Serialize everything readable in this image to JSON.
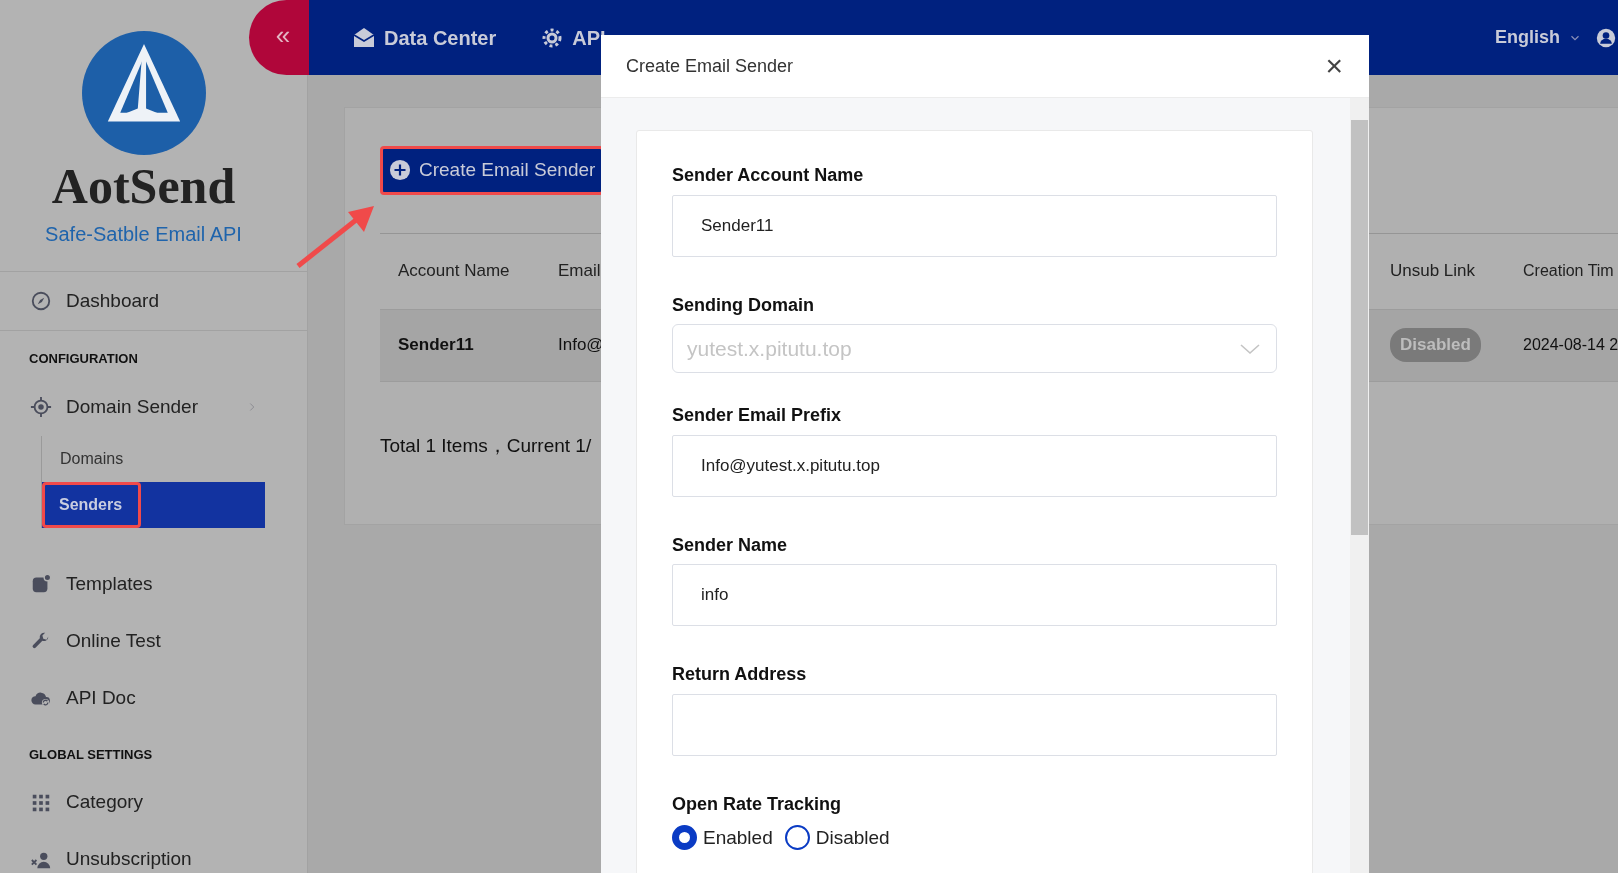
{
  "sidebar": {
    "collapse_button": "«",
    "logo": {
      "name": "AotSend",
      "tagline": "Safe-Satble Email API"
    },
    "items": [
      {
        "kind": "link",
        "label": "Dashboard",
        "divider": true
      },
      {
        "kind": "heading",
        "label": "CONFIGURATION"
      },
      {
        "kind": "group",
        "label": "Domain Sender",
        "children": [
          {
            "label": "Domains",
            "selected": false,
            "highlighted": false
          },
          {
            "label": "Senders",
            "selected": true,
            "highlighted": true
          }
        ]
      },
      {
        "kind": "link",
        "label": "Templates"
      },
      {
        "kind": "link",
        "label": "Online Test"
      },
      {
        "kind": "link",
        "label": "API Doc"
      },
      {
        "kind": "heading",
        "label": "GLOBAL SETTINGS"
      },
      {
        "kind": "link",
        "label": "Category"
      },
      {
        "kind": "link",
        "label": "Unsubscription"
      }
    ]
  },
  "top_bar": {
    "nav": [
      {
        "label": "Data Center"
      },
      {
        "label": "API"
      }
    ],
    "language": "English"
  },
  "content": {
    "create_button": {
      "label": "Create Email Sender",
      "highlighted": true
    },
    "table": {
      "columns": [
        {
          "label": "Account Name",
          "kind": "text"
        },
        {
          "label": "Email",
          "kind": "text"
        },
        {
          "label": "Unsub Link",
          "kind": "badge"
        },
        {
          "label": "Creation Tim",
          "kind": "text"
        }
      ],
      "rows": [
        {
          "cells": [
            "Sender11",
            "Info@",
            "Disabled",
            "2024-08-14 2"
          ]
        }
      ]
    },
    "pagination": "Total 1 Items，Current 1/"
  },
  "modal": {
    "title": "Create Email Sender",
    "close": "×",
    "fields": [
      {
        "kind": "input",
        "label": "Sender Account Name",
        "value": "Sender11"
      },
      {
        "kind": "select",
        "label": "Sending Domain",
        "value": "yutest.x.pitutu.top",
        "disabled": true
      },
      {
        "kind": "input",
        "label": "Sender Email Prefix",
        "value": "Info@yutest.x.pitutu.top"
      },
      {
        "kind": "input",
        "label": "Sender Name",
        "value": "info"
      },
      {
        "kind": "input",
        "label": "Return Address"
      },
      {
        "kind": "radio",
        "label": "Open Rate Tracking",
        "options": [
          {
            "label": "Enabled",
            "selected": true
          },
          {
            "label": "Disabled",
            "selected": false
          }
        ]
      }
    ]
  }
}
